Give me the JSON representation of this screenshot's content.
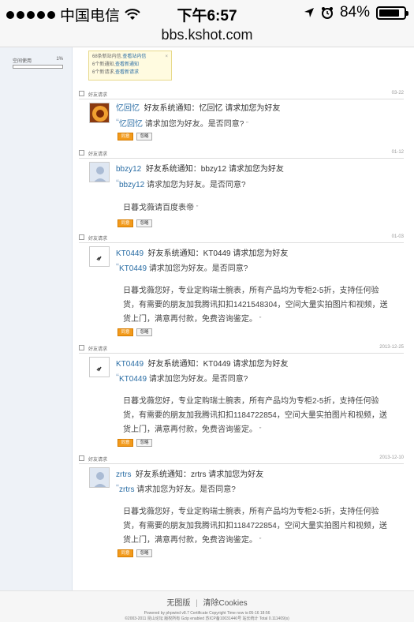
{
  "status_bar": {
    "carrier": "中国电信",
    "time": "下午6:57",
    "battery": "84%",
    "battery_level": 0.84
  },
  "url_bar": {
    "host": "bbs.kshot.com"
  },
  "sidebar": {
    "space_label": "空间使用",
    "space_percent": "1%"
  },
  "notice": {
    "line1_prefix": "68条新站内信,",
    "line1_link": "查看站内信",
    "line2_prefix": "6个新通知,",
    "line2_link": "查看新通知",
    "line3_prefix": "6个新请求,",
    "line3_link": "查看新请求",
    "close": "×"
  },
  "messages": [
    {
      "type": "好友请求",
      "date": "03-22",
      "username": "忆回忆",
      "title_text": "好友系统通知：忆回忆 请求加您为好友",
      "quote_text": "请求加您为好友。是否同意?",
      "body": "",
      "agree": "同意",
      "ignore": "忽略"
    },
    {
      "type": "好友请求",
      "date": "01-12",
      "username": "bbzy12",
      "title_text": "好友系统通知：bbzy12 请求加您为好友",
      "quote_text": "请求加您为好友。是否同意?",
      "body": "日暮戈薇请百度表帝",
      "agree": "同意",
      "ignore": "忽略"
    },
    {
      "type": "好友请求",
      "date": "01-03",
      "username": "KT0449",
      "title_text": "好友系统通知：KT0449 请求加您为好友",
      "quote_text": "请求加您为好友。是否同意?",
      "body": "日暮戈薇您好，专业定购瑞士腕表，所有产品均为专柜2-5折，支持任何验货，有需要的朋友加我腾讯扣扣1421548304，空间大量实拍图片和视频，送货上门，满意再付款，免费咨询鉴定。",
      "agree": "同意",
      "ignore": "忽略"
    },
    {
      "type": "好友请求",
      "date": "2013-12-25",
      "username": "KT0449",
      "title_text": "好友系统通知：KT0449 请求加您为好友",
      "quote_text": "请求加您为好友。是否同意?",
      "body": "日暮戈薇您好，专业定购瑞士腕表，所有产品均为专柜2-5折，支持任何验货，有需要的朋友加我腾讯扣扣1184722854，空间大量实拍图片和视频，送货上门，满意再付款，免费咨询鉴定。",
      "agree": "同意",
      "ignore": "忽略"
    },
    {
      "type": "好友请求",
      "date": "2013-12-10",
      "username": "zrtrs",
      "title_text": "好友系统通知：zrtrs 请求加您为好友",
      "quote_text": "请求加您为好友。是否同意?",
      "body": "日暮戈薇您好，专业定购瑞士腕表，所有产品均为专柜2-5折，支持任何验货，有需要的朋友加我腾讯扣扣1184722854，空间大量实拍图片和视频，送货上门，满意再付款，免费咨询鉴定。",
      "agree": "同意",
      "ignore": "忽略"
    }
  ],
  "footer": {
    "link_noimage": "无图版",
    "sep": "|",
    "link_clear": "清除Cookies",
    "powered": "Powered by phpwind v8.7 Certificate Copyright Time now is:05-16 18:56",
    "copyright": "©2003-2011 昆山论坛 版权所有 Gzip enabled 苏ICP备10031446号 站长统计 Total 0.111409(s)"
  }
}
